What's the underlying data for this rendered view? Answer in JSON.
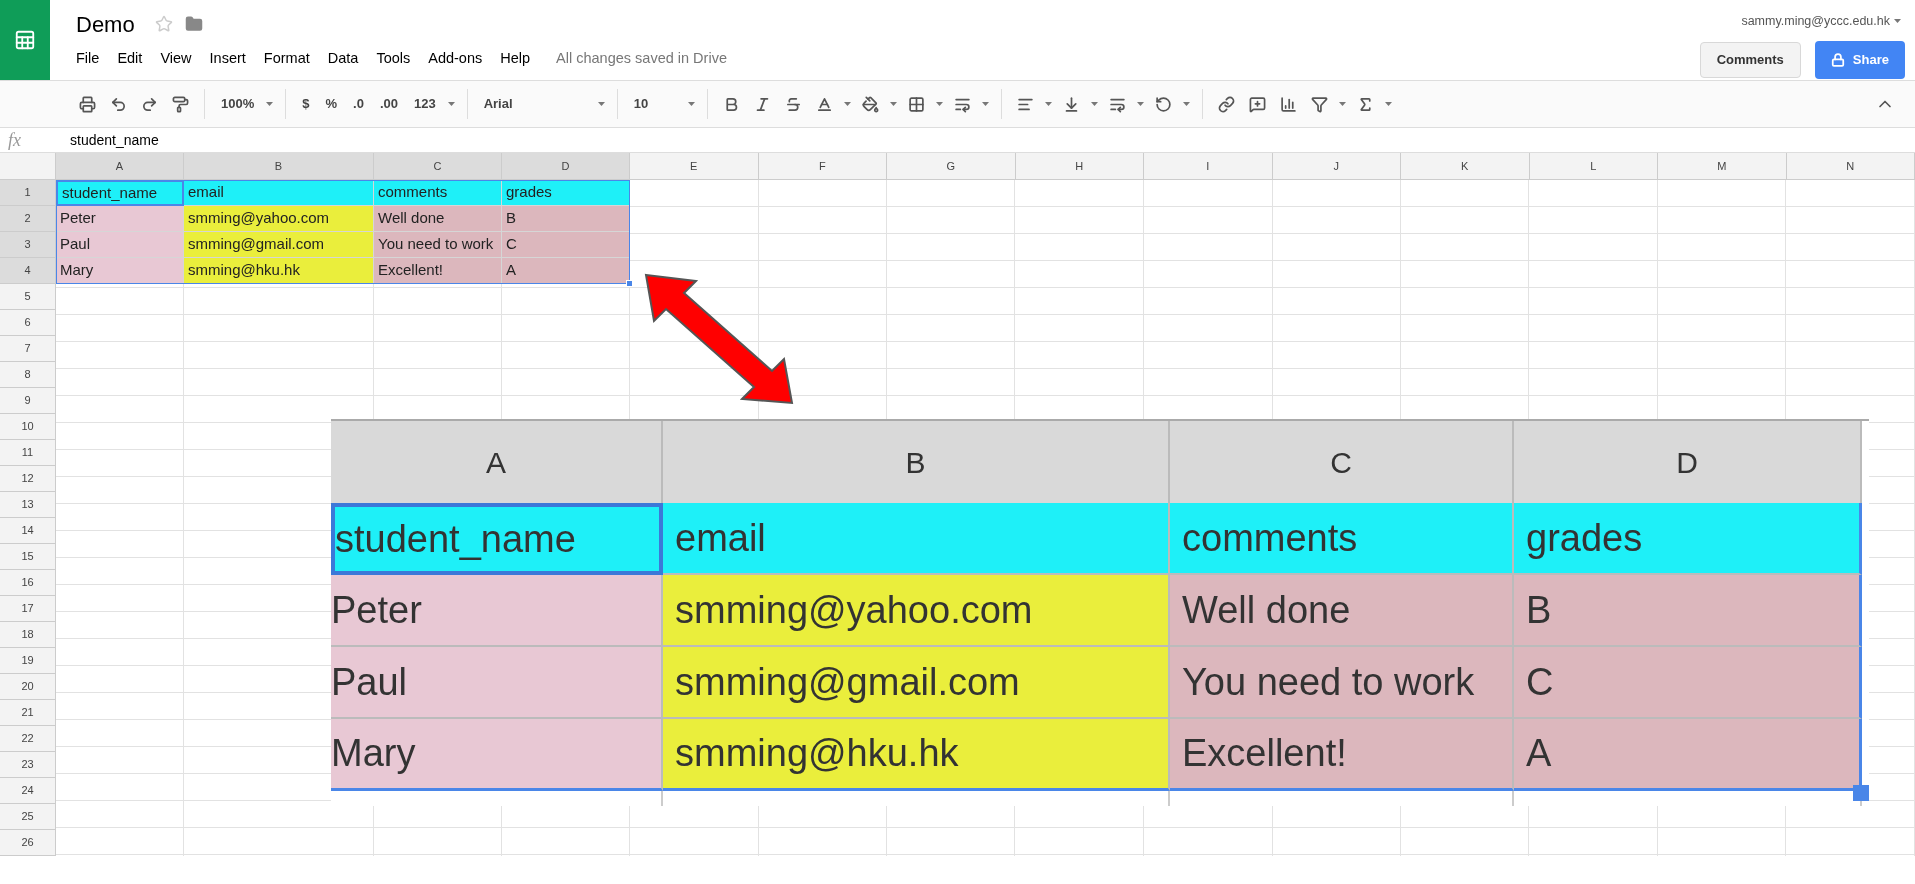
{
  "app": {
    "title": "Demo",
    "menu": [
      "File",
      "Edit",
      "View",
      "Insert",
      "Format",
      "Data",
      "Tools",
      "Add-ons",
      "Help"
    ],
    "save_status": "All changes saved in Drive",
    "account": "sammy.ming@yccc.edu.hk",
    "buttons": [
      {
        "kind": "comments",
        "label": "Comments"
      },
      {
        "kind": "share",
        "label": "Share"
      }
    ]
  },
  "toolbar": {
    "zoom": "100%",
    "currency": "$",
    "percent": "%",
    "decrease_decimals": ".0",
    "increase_decimals": ".00",
    "more_formats": "123",
    "font": "Arial",
    "font_size": "10"
  },
  "formula_bar": {
    "label": "fx",
    "value": "student_name"
  },
  "sheet": {
    "columns": [
      "A",
      "B",
      "C",
      "D",
      "E",
      "F",
      "G",
      "H",
      "I",
      "J",
      "K",
      "L",
      "M",
      "N"
    ],
    "row_numbers": [
      "1",
      "2",
      "3",
      "4",
      "5",
      "6",
      "7",
      "8",
      "9",
      "10",
      "11",
      "12",
      "13",
      "14",
      "15",
      "16",
      "17",
      "18",
      "19",
      "20",
      "21",
      "22",
      "23",
      "24",
      "25",
      "26"
    ],
    "rows": [
      [
        {
          "text": "student_name",
          "color": "#1ef0f8",
          "selected": true
        },
        {
          "text": "email",
          "color": "#1ef0f8",
          "selected": false
        },
        {
          "text": "comments",
          "color": "#1ef0f8",
          "selected": false
        },
        {
          "text": "grades",
          "color": "#1ef0f8",
          "selected": false
        }
      ],
      [
        {
          "text": "Peter",
          "color": "#e8c8d4",
          "selected": false
        },
        {
          "text": "smming@yahoo.com",
          "color": "#eaee3c",
          "selected": false
        },
        {
          "text": "Well done",
          "color": "#dcb7bd",
          "selected": false
        },
        {
          "text": "B",
          "color": "#dcb7bd",
          "selected": false
        }
      ],
      [
        {
          "text": "Paul",
          "color": "#e8c8d4",
          "selected": false
        },
        {
          "text": "smming@gmail.com",
          "color": "#eaee3c",
          "selected": false
        },
        {
          "text": "You need to work",
          "color": "#dcb7bd",
          "selected": false
        },
        {
          "text": "C",
          "color": "#dcb7bd",
          "selected": false
        }
      ],
      [
        {
          "text": "Mary",
          "color": "#e8c8d4",
          "selected": false
        },
        {
          "text": "smming@hku.hk",
          "color": "#eaee3c",
          "selected": false
        },
        {
          "text": "Excellent!",
          "color": "#dcb7bd",
          "selected": false
        },
        {
          "text": "A",
          "color": "#dcb7bd",
          "selected": false
        }
      ]
    ]
  },
  "zoomed_inset": {
    "columns": [
      "A",
      "B",
      "C",
      "D"
    ],
    "rows": [
      [
        {
          "text": "student_name",
          "color": "#1ef0f8",
          "selected": true
        },
        {
          "text": "email",
          "color": "#1ef0f8",
          "selected": false
        },
        {
          "text": "comments",
          "color": "#1ef0f8",
          "selected": false
        },
        {
          "text": "grades",
          "color": "#1ef0f8",
          "selected": false
        }
      ],
      [
        {
          "text": "Peter",
          "color": "#e8c8d4",
          "selected": false
        },
        {
          "text": "smming@yahoo.com",
          "color": "#eaee3c",
          "selected": false
        },
        {
          "text": "Well done",
          "color": "#dcb7bd",
          "selected": false
        },
        {
          "text": "B",
          "color": "#dcb7bd",
          "selected": false
        }
      ],
      [
        {
          "text": "Paul",
          "color": "#e8c8d4",
          "selected": false
        },
        {
          "text": "smming@gmail.com",
          "color": "#eaee3c",
          "selected": false
        },
        {
          "text": "You need to work",
          "color": "#dcb7bd",
          "selected": false
        },
        {
          "text": "C",
          "color": "#dcb7bd",
          "selected": false
        }
      ],
      [
        {
          "text": "Mary",
          "color": "#e8c8d4",
          "selected": false
        },
        {
          "text": "smming@hku.hk",
          "color": "#eaee3c",
          "selected": false
        },
        {
          "text": "Excellent!",
          "color": "#dcb7bd",
          "selected": false
        },
        {
          "text": "A",
          "color": "#dcb7bd",
          "selected": false
        }
      ]
    ]
  }
}
